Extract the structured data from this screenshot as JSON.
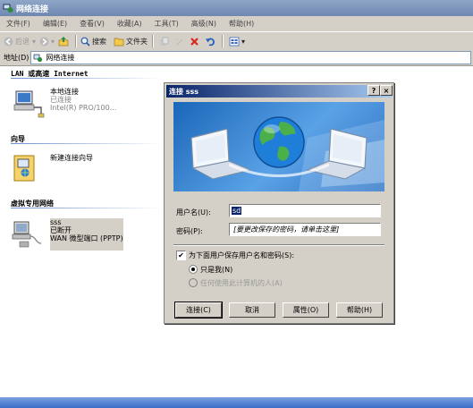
{
  "window": {
    "title": "网络连接"
  },
  "menu": [
    "文件(F)",
    "编辑(E)",
    "查看(V)",
    "收藏(A)",
    "工具(T)",
    "高级(N)",
    "帮助(H)"
  ],
  "toolbar": {
    "back": "后退",
    "search": "搜索",
    "folders": "文件夹"
  },
  "address": {
    "label": "地址(D)",
    "value": "网络连接"
  },
  "groups": {
    "lan": {
      "header": "LAN 或高速 Internet",
      "item": {
        "name": "本地连接",
        "status": "已连接",
        "device": "Intel(R) PRO/100..."
      }
    },
    "wizard": {
      "header": "向导",
      "item": {
        "name": "新建连接向导"
      }
    },
    "vpn": {
      "header": "虚拟专用网络",
      "item": {
        "name": "sss",
        "status": "已断开",
        "device": "WAN 微型端口 (PPTP)"
      }
    }
  },
  "dialog": {
    "title": "连接 sss",
    "help_btn": "?",
    "close_btn": "×",
    "username_label": "用户名(U):",
    "username_value": "sd",
    "password_label": "密码(P):",
    "password_placeholder": "[要更改保存的密码，请单击这里]",
    "save_label": "为下面用户保存用户名和密码(S):",
    "save_checked": true,
    "opt_me": "只是我(N)",
    "opt_anyone": "任何使用此计算机的人(A)",
    "buttons": {
      "connect": "连接(C)",
      "cancel": "取消",
      "properties": "属性(O)",
      "help": "帮助(H)"
    }
  },
  "colors": {
    "title_active": "#0a246a",
    "face": "#d4d0c8",
    "banner": "#1a66b8"
  }
}
